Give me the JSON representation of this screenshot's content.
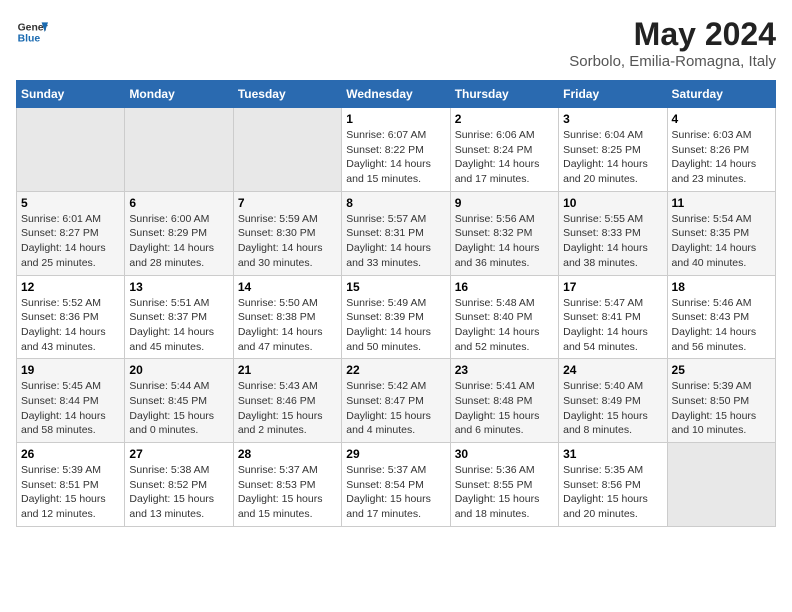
{
  "header": {
    "logo_general": "General",
    "logo_blue": "Blue",
    "main_title": "May 2024",
    "subtitle": "Sorbolo, Emilia-Romagna, Italy"
  },
  "days_of_week": [
    "Sunday",
    "Monday",
    "Tuesday",
    "Wednesday",
    "Thursday",
    "Friday",
    "Saturday"
  ],
  "weeks": [
    [
      {
        "day": "",
        "info": ""
      },
      {
        "day": "",
        "info": ""
      },
      {
        "day": "",
        "info": ""
      },
      {
        "day": "1",
        "info": "Sunrise: 6:07 AM\nSunset: 8:22 PM\nDaylight: 14 hours\nand 15 minutes."
      },
      {
        "day": "2",
        "info": "Sunrise: 6:06 AM\nSunset: 8:24 PM\nDaylight: 14 hours\nand 17 minutes."
      },
      {
        "day": "3",
        "info": "Sunrise: 6:04 AM\nSunset: 8:25 PM\nDaylight: 14 hours\nand 20 minutes."
      },
      {
        "day": "4",
        "info": "Sunrise: 6:03 AM\nSunset: 8:26 PM\nDaylight: 14 hours\nand 23 minutes."
      }
    ],
    [
      {
        "day": "5",
        "info": "Sunrise: 6:01 AM\nSunset: 8:27 PM\nDaylight: 14 hours\nand 25 minutes."
      },
      {
        "day": "6",
        "info": "Sunrise: 6:00 AM\nSunset: 8:29 PM\nDaylight: 14 hours\nand 28 minutes."
      },
      {
        "day": "7",
        "info": "Sunrise: 5:59 AM\nSunset: 8:30 PM\nDaylight: 14 hours\nand 30 minutes."
      },
      {
        "day": "8",
        "info": "Sunrise: 5:57 AM\nSunset: 8:31 PM\nDaylight: 14 hours\nand 33 minutes."
      },
      {
        "day": "9",
        "info": "Sunrise: 5:56 AM\nSunset: 8:32 PM\nDaylight: 14 hours\nand 36 minutes."
      },
      {
        "day": "10",
        "info": "Sunrise: 5:55 AM\nSunset: 8:33 PM\nDaylight: 14 hours\nand 38 minutes."
      },
      {
        "day": "11",
        "info": "Sunrise: 5:54 AM\nSunset: 8:35 PM\nDaylight: 14 hours\nand 40 minutes."
      }
    ],
    [
      {
        "day": "12",
        "info": "Sunrise: 5:52 AM\nSunset: 8:36 PM\nDaylight: 14 hours\nand 43 minutes."
      },
      {
        "day": "13",
        "info": "Sunrise: 5:51 AM\nSunset: 8:37 PM\nDaylight: 14 hours\nand 45 minutes."
      },
      {
        "day": "14",
        "info": "Sunrise: 5:50 AM\nSunset: 8:38 PM\nDaylight: 14 hours\nand 47 minutes."
      },
      {
        "day": "15",
        "info": "Sunrise: 5:49 AM\nSunset: 8:39 PM\nDaylight: 14 hours\nand 50 minutes."
      },
      {
        "day": "16",
        "info": "Sunrise: 5:48 AM\nSunset: 8:40 PM\nDaylight: 14 hours\nand 52 minutes."
      },
      {
        "day": "17",
        "info": "Sunrise: 5:47 AM\nSunset: 8:41 PM\nDaylight: 14 hours\nand 54 minutes."
      },
      {
        "day": "18",
        "info": "Sunrise: 5:46 AM\nSunset: 8:43 PM\nDaylight: 14 hours\nand 56 minutes."
      }
    ],
    [
      {
        "day": "19",
        "info": "Sunrise: 5:45 AM\nSunset: 8:44 PM\nDaylight: 14 hours\nand 58 minutes."
      },
      {
        "day": "20",
        "info": "Sunrise: 5:44 AM\nSunset: 8:45 PM\nDaylight: 15 hours\nand 0 minutes."
      },
      {
        "day": "21",
        "info": "Sunrise: 5:43 AM\nSunset: 8:46 PM\nDaylight: 15 hours\nand 2 minutes."
      },
      {
        "day": "22",
        "info": "Sunrise: 5:42 AM\nSunset: 8:47 PM\nDaylight: 15 hours\nand 4 minutes."
      },
      {
        "day": "23",
        "info": "Sunrise: 5:41 AM\nSunset: 8:48 PM\nDaylight: 15 hours\nand 6 minutes."
      },
      {
        "day": "24",
        "info": "Sunrise: 5:40 AM\nSunset: 8:49 PM\nDaylight: 15 hours\nand 8 minutes."
      },
      {
        "day": "25",
        "info": "Sunrise: 5:39 AM\nSunset: 8:50 PM\nDaylight: 15 hours\nand 10 minutes."
      }
    ],
    [
      {
        "day": "26",
        "info": "Sunrise: 5:39 AM\nSunset: 8:51 PM\nDaylight: 15 hours\nand 12 minutes."
      },
      {
        "day": "27",
        "info": "Sunrise: 5:38 AM\nSunset: 8:52 PM\nDaylight: 15 hours\nand 13 minutes."
      },
      {
        "day": "28",
        "info": "Sunrise: 5:37 AM\nSunset: 8:53 PM\nDaylight: 15 hours\nand 15 minutes."
      },
      {
        "day": "29",
        "info": "Sunrise: 5:37 AM\nSunset: 8:54 PM\nDaylight: 15 hours\nand 17 minutes."
      },
      {
        "day": "30",
        "info": "Sunrise: 5:36 AM\nSunset: 8:55 PM\nDaylight: 15 hours\nand 18 minutes."
      },
      {
        "day": "31",
        "info": "Sunrise: 5:35 AM\nSunset: 8:56 PM\nDaylight: 15 hours\nand 20 minutes."
      },
      {
        "day": "",
        "info": ""
      }
    ]
  ]
}
